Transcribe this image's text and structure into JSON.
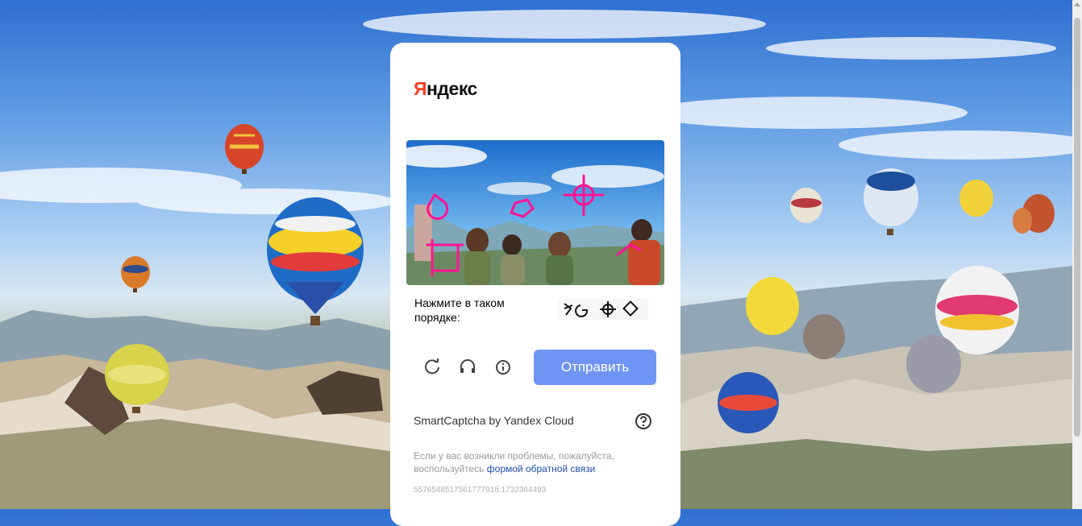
{
  "logo": {
    "first_letter": "Я",
    "rest": "ндекс"
  },
  "captcha": {
    "instruction": "Нажмите в таком порядке:",
    "submit_label": "Отправить"
  },
  "icons": {
    "refresh": "refresh-icon",
    "audio": "headphones-icon",
    "info": "info-icon",
    "help": "question-icon"
  },
  "footer": {
    "brand": "SmartCaptcha by Yandex Cloud",
    "help_text_prefix": "Если у вас возникли проблемы, пожалуйста, воспользуйтесь",
    "help_link": "формой обратной связи",
    "request_id": "557654851756177791б:1732364493"
  },
  "colors": {
    "logo_red": "#fc3f1d",
    "submit_blue": "#6f95f4",
    "link_blue": "#1e4fb5",
    "marker_magenta": "#ff1493"
  }
}
